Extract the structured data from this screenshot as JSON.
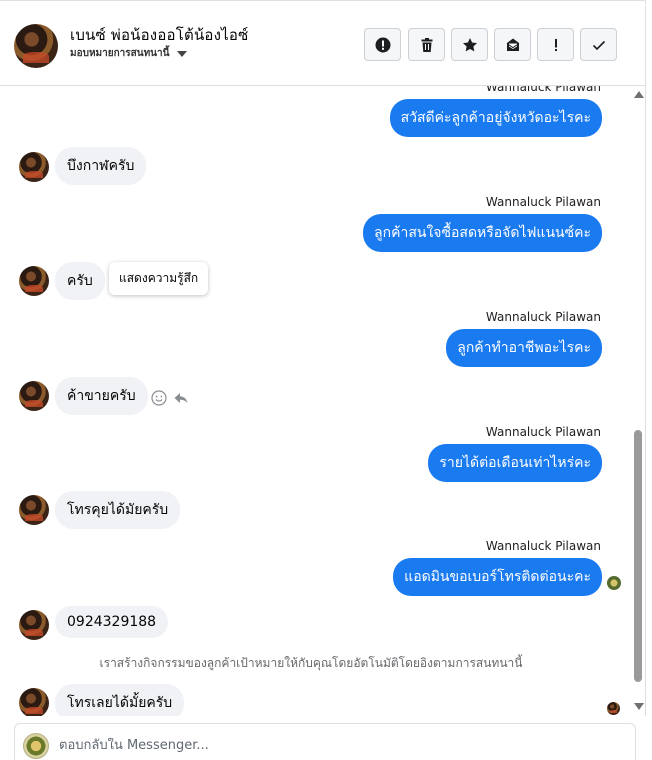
{
  "header": {
    "name": "เบนซ์ พ่อน้องออโต้น้องไอซ์",
    "subtitle": "มอบหมายการสนทนานี้",
    "buttons": [
      {
        "name": "report-button",
        "icon": "exclamation-circle-icon"
      },
      {
        "name": "delete-button",
        "icon": "trash-icon"
      },
      {
        "name": "star-button",
        "icon": "star-icon"
      },
      {
        "name": "mark-unread-button",
        "icon": "envelope-icon"
      },
      {
        "name": "flag-important-button",
        "icon": "exclamation-icon"
      },
      {
        "name": "mark-done-button",
        "icon": "check-icon"
      }
    ]
  },
  "messages": [
    {
      "dir": "out",
      "sender": "Wannaluck Pilawan",
      "text": "สวัสดีค่ะลูกค้าอยู่จังหวัดอะไรคะ"
    },
    {
      "dir": "in",
      "text": "บึงกาฬครับ"
    },
    {
      "dir": "out",
      "sender": "Wannaluck Pilawan",
      "text": "ลูกค้าสนใจซื้อสดหรือจัดไฟแนนซ์คะ"
    },
    {
      "dir": "in",
      "text": "ครับ"
    },
    {
      "dir": "out",
      "sender": "Wannaluck Pilawan",
      "text": "ลูกค้าทำอาชีพอะไรคะ"
    },
    {
      "dir": "in",
      "text": "ค้าขายครับ"
    },
    {
      "dir": "out",
      "sender": "Wannaluck Pilawan",
      "text": "รายได้ต่อเดือนเท่าไหร่คะ"
    },
    {
      "dir": "in",
      "text": "โทรคุยได้มัยครับ"
    },
    {
      "dir": "out",
      "sender": "Wannaluck Pilawan",
      "text": "แอดมินขอเบอร์โทรติดต่อนะคะ"
    },
    {
      "dir": "in",
      "text": "0924329188"
    },
    {
      "dir": "in",
      "text": "โทรเลยได้มั้ยครับ"
    }
  ],
  "tooltip": "แสดงความรู้สึก",
  "system_note": "เราสร้างกิจกรรมของลูกค้าเป้าหมายให้กับคุณโดยอัตโนมัติโดยอิงตามการสนทนานี้",
  "composer": {
    "placeholder": "ตอบกลับใน Messenger..."
  },
  "colors": {
    "outgoing_bubble": "#1a7af0",
    "incoming_bubble": "#f0f2f5"
  }
}
